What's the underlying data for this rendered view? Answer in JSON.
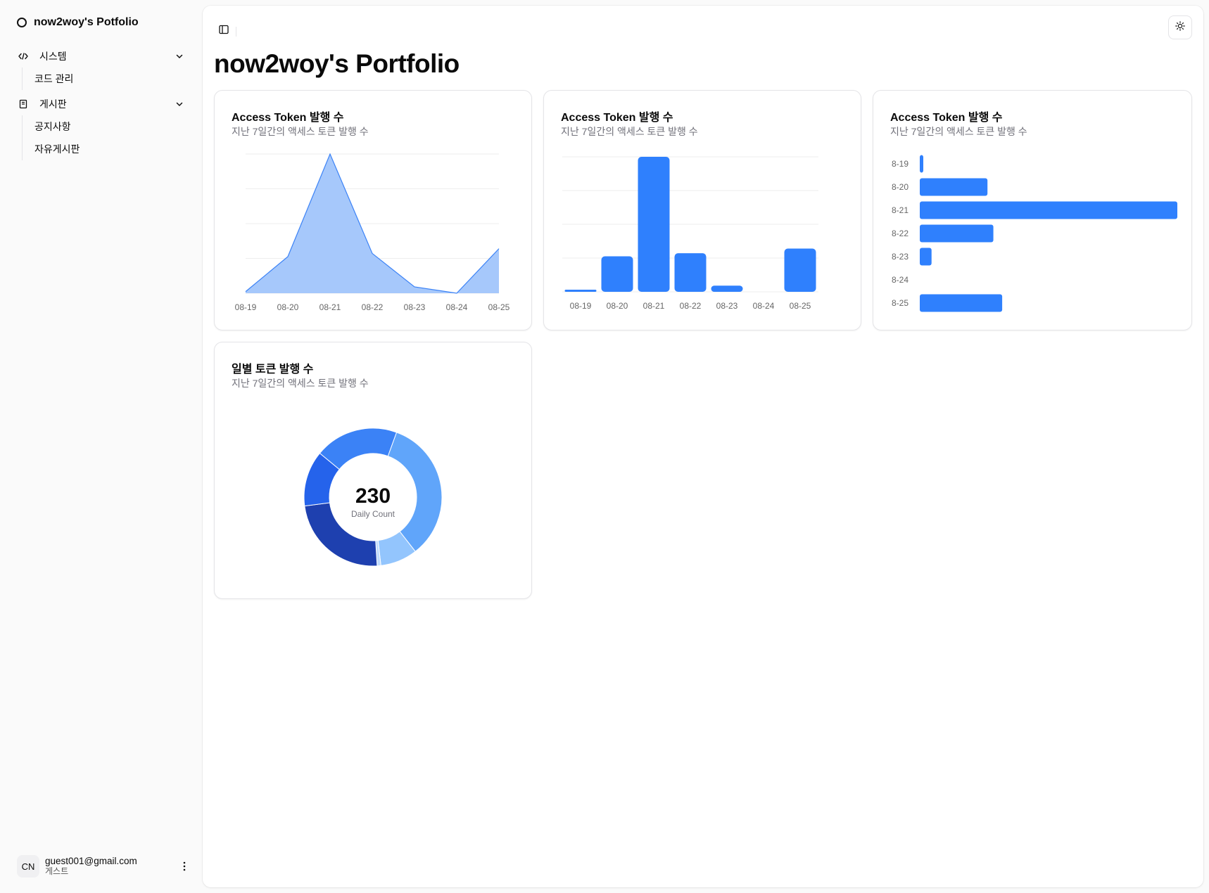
{
  "sidebar": {
    "brand": "now2woy's Potfolio",
    "groups": [
      {
        "label": "시스템",
        "icon": "code-icon",
        "items": [
          "코드 관리"
        ]
      },
      {
        "label": "게시판",
        "icon": "book-icon",
        "items": [
          "공지사항",
          "자유게시판"
        ]
      }
    ],
    "user": {
      "avatar": "CN",
      "email": "guest001@gmail.com",
      "role": "게스트"
    }
  },
  "header": {
    "title": "now2woy's Portfolio",
    "toggle_icon": "sidebar-toggle-icon",
    "theme_icon": "sun-icon"
  },
  "cards": [
    {
      "title": "Access Token 발행 수",
      "desc": "지난 7일간의 액세스 토큰 발행 수"
    },
    {
      "title": "Access Token 발행 수",
      "desc": "지난 7일간의 액세스 토큰 발행 수"
    },
    {
      "title": "Access Token 발행 수",
      "desc": "지난 7일간의 액세스 토큰 발행 수"
    },
    {
      "title": "일별 토큰 발행 수",
      "desc": "지난 7일간의 액세스 토큰 발행 수"
    }
  ],
  "chart_data": [
    {
      "type": "area",
      "categories": [
        "08-19",
        "08-20",
        "08-21",
        "08-22",
        "08-23",
        "08-24",
        "08-25"
      ],
      "values": [
        2,
        46,
        175,
        50,
        8,
        0,
        56
      ],
      "ylim": [
        0,
        175
      ],
      "grid": true,
      "colors": {
        "fill": "#a6c8fb",
        "stroke": "#3b82f6"
      }
    },
    {
      "type": "bar",
      "categories": [
        "08-19",
        "08-20",
        "08-21",
        "08-22",
        "08-23",
        "08-24",
        "08-25"
      ],
      "values": [
        2,
        46,
        175,
        50,
        8,
        0,
        56
      ],
      "ylim": [
        0,
        175
      ],
      "grid": true,
      "colors": {
        "bar": "#2f80fd"
      }
    },
    {
      "type": "bar",
      "orientation": "horizontal",
      "categories": [
        "8-19",
        "8-20",
        "8-21",
        "8-22",
        "8-23",
        "8-24",
        "8-25"
      ],
      "values": [
        2,
        46,
        175,
        50,
        8,
        0,
        56
      ],
      "colors": {
        "bar": "#2f80fd"
      }
    },
    {
      "type": "pie",
      "donut": true,
      "center_value": "230",
      "center_label": "Daily Count",
      "values": [
        78,
        20,
        2,
        55,
        30,
        45
      ],
      "colors": [
        "#60a5fa",
        "#93c5fd",
        "#bfdbfe",
        "#1e40af",
        "#2563eb",
        "#3b82f6"
      ]
    }
  ]
}
